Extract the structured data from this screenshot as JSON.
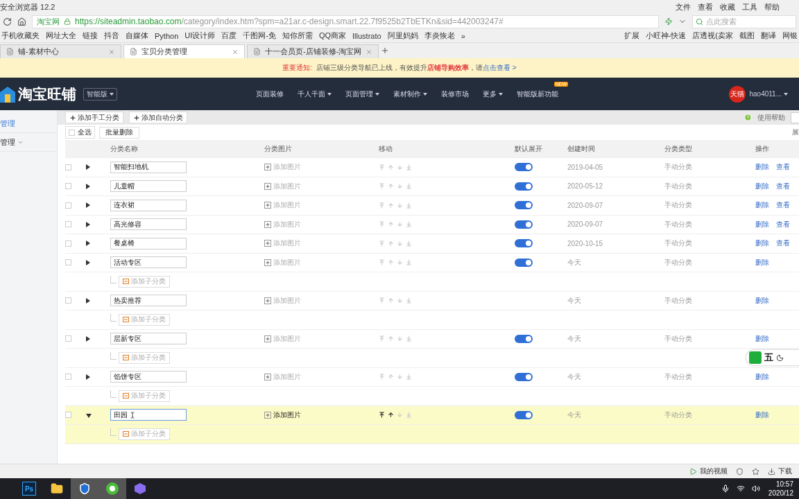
{
  "window": {
    "title": "安全浏览器 12.2",
    "menu": [
      "文件",
      "查看",
      "收藏",
      "工具",
      "帮助"
    ]
  },
  "address_bar": {
    "site": "淘宝网",
    "url_host": "https://siteadmin.taobao.com",
    "url_path": "/category/index.htm?spm=a21ar.c-design.smart.22.7f9525b2TbETKn&sid=442003247#",
    "search_placeholder": "点此搜索"
  },
  "bookmarks": [
    "手机收藏夹",
    "网址大全",
    "链接",
    "抖音",
    "自媒体",
    "Python",
    "UI设计师",
    "百度",
    "千图网-免",
    "知你所需",
    "QQ商家",
    "Illustrato",
    "阿里妈妈",
    "李炎恢老",
    "»"
  ],
  "extensions": [
    "扩展",
    "小旺神-快速",
    "店透视(卖家",
    "截图",
    "翻译",
    "网银"
  ],
  "tabs": [
    {
      "label": "铺-素材中心",
      "selected": false
    },
    {
      "label": "宝贝分类管理",
      "selected": true
    },
    {
      "label": "十一会员页-店铺装修-淘宝网",
      "selected": false
    }
  ],
  "notice": {
    "label": "重要通知:",
    "text": "店铺三级分类导航已上线，有效提升**店铺导购效率**，请",
    "link": "点击查看 >"
  },
  "header": {
    "logo": "淘宝旺铺",
    "edition": "智能版",
    "nav": [
      {
        "label": "页面装修",
        "menu": false
      },
      {
        "label": "千人千面",
        "menu": true
      },
      {
        "label": "页面管理",
        "menu": true
      },
      {
        "label": "素材制作",
        "menu": true
      },
      {
        "label": "装修市场",
        "menu": false
      },
      {
        "label": "更多",
        "menu": true
      },
      {
        "label": "智能版新功能",
        "menu": false,
        "badge": "NEW"
      }
    ],
    "avatar": "天猫",
    "user": "hao4011..."
  },
  "sidebar": {
    "items": [
      {
        "label": "管理",
        "selected": true,
        "menu": false
      },
      {
        "label": "管理",
        "selected": false,
        "menu": true
      }
    ]
  },
  "toolbar": {
    "buttons": [
      "添加手工分类",
      "添加自动分类"
    ],
    "help": "使用帮助",
    "select_all": "全选",
    "select_all_checked": false,
    "batch_delete": "批量删除",
    "right_text": "展"
  },
  "table": {
    "columns": [
      "分类名称",
      "分类图片",
      "移动",
      "默认展开",
      "创建时间",
      "分类类型",
      "操作"
    ],
    "rows": [
      {
        "name": "智能扫地机",
        "image": "添加图片",
        "can_move_up": false,
        "can_move_down": false,
        "default_expand": true,
        "created": "2019-04-05",
        "type": "手动分类",
        "actions": [
          "删除",
          "查看"
        ],
        "expanded": false,
        "selected": false,
        "editing": false
      },
      {
        "name": "儿童帽",
        "image": "添加图片",
        "can_move_up": false,
        "can_move_down": false,
        "default_expand": true,
        "created": "2020-05-12",
        "type": "手动分类",
        "actions": [
          "删除",
          "查看"
        ],
        "expanded": false,
        "selected": false,
        "editing": false
      },
      {
        "name": "连衣裙",
        "image": "添加图片",
        "can_move_up": false,
        "can_move_down": false,
        "default_expand": true,
        "created": "2020-09-07",
        "type": "手动分类",
        "actions": [
          "删除",
          "查看"
        ],
        "expanded": false,
        "selected": false,
        "editing": false
      },
      {
        "name": "高光修容",
        "image": "添加图片",
        "can_move_up": false,
        "can_move_down": false,
        "default_expand": true,
        "created": "2020-09-07",
        "type": "手动分类",
        "actions": [
          "删除",
          "查看"
        ],
        "expanded": false,
        "selected": false,
        "editing": false
      },
      {
        "name": "餐桌椅",
        "image": "添加图片",
        "can_move_up": false,
        "can_move_down": false,
        "default_expand": true,
        "created": "2020-10-15",
        "type": "手动分类",
        "actions": [
          "删除",
          "查看"
        ],
        "expanded": false,
        "selected": false,
        "editing": false
      },
      {
        "name": "活动专区",
        "image": "添加图片",
        "can_move_up": false,
        "can_move_down": false,
        "default_expand": true,
        "created": "今天",
        "type": "手动分类",
        "actions": [
          "删除"
        ],
        "expanded": false,
        "selected": false,
        "editing": false,
        "add_child": "添加子分类"
      },
      {
        "name": "热卖推荐",
        "image": "添加图片",
        "can_move_up": false,
        "can_move_down": false,
        "created": "今天",
        "type": "手动分类",
        "actions": [
          "删除"
        ],
        "expanded": false,
        "selected": false,
        "editing": false,
        "add_child": "添加子分类"
      },
      {
        "name": "层新专区",
        "image": "添加图片",
        "can_move_up": false,
        "can_move_down": false,
        "default_expand": true,
        "created": "今天",
        "type": "手动分类",
        "actions": [
          "删除"
        ],
        "expanded": false,
        "selected": false,
        "editing": false,
        "add_child": "添加子分类"
      },
      {
        "name": "馅饼专区",
        "image": "添加图片",
        "can_move_up": false,
        "can_move_down": false,
        "default_expand": true,
        "created": "今天",
        "type": "手动分类",
        "actions": [
          "删除"
        ],
        "expanded": false,
        "selected": false,
        "editing": false,
        "add_child": "添加子分类"
      },
      {
        "name": "田园",
        "image": "添加图片",
        "can_move_up": true,
        "can_move_down": false,
        "default_expand": true,
        "created": "今天",
        "type": "手动分类",
        "actions": [
          "删除"
        ],
        "expanded": true,
        "selected": true,
        "editing": true,
        "add_child": "添加子分类"
      }
    ]
  },
  "ime": {
    "label": "五"
  },
  "status_bar": {
    "video": "我的视频",
    "download": "下载"
  },
  "taskbar": {
    "apps": [
      {
        "kind": "text",
        "label": "Ps"
      },
      {
        "kind": "folder"
      },
      {
        "kind": "shield"
      },
      {
        "kind": "browser"
      },
      {
        "kind": "cube"
      }
    ],
    "time": "10:57",
    "date": "2020/12"
  }
}
